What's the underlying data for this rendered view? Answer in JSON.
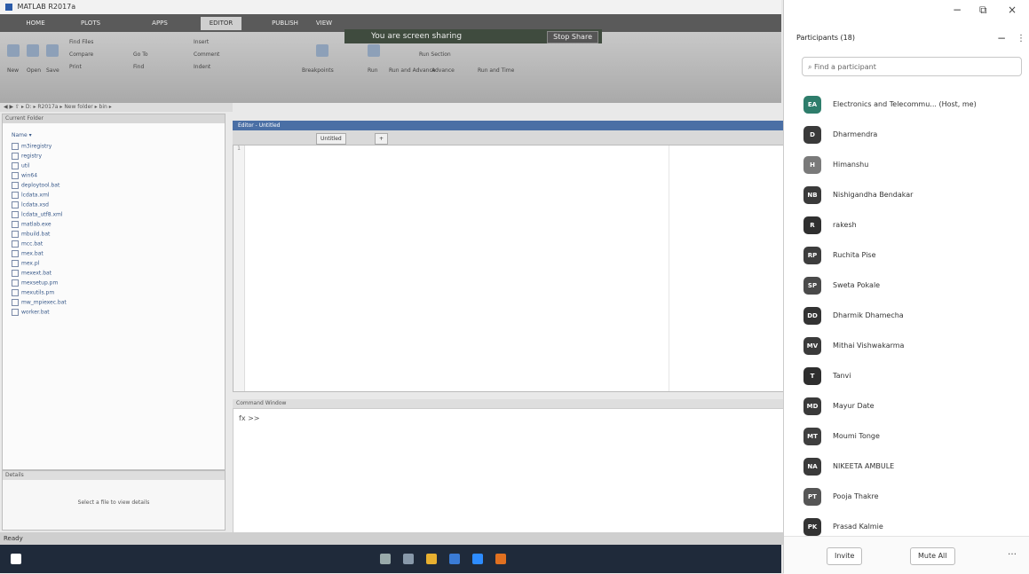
{
  "window": {
    "title": "MATLAB R2017a"
  },
  "ribbon_tabs": [
    "HOME",
    "PLOTS",
    "APPS",
    "EDITOR",
    "PUBLISH",
    "VIEW"
  ],
  "share_banner": {
    "text": "You are screen sharing",
    "stop_label": "Stop Share"
  },
  "ribbon": {
    "items": [
      "New",
      "Open",
      "Save",
      "Find Files",
      "Compare",
      "Print",
      "Go To",
      "Find",
      "Insert",
      "Comment",
      "Indent",
      "Breakpoints",
      "Run",
      "Run and Advance",
      "Run Section",
      "Advance",
      "Run and Time"
    ]
  },
  "address_bar": {
    "path": "▸ D: ▸ R2017a ▸ New folder ▸ bin ▸"
  },
  "current_folder": {
    "header": "Current Folder",
    "name_col": "Name ▾",
    "items": [
      "m3iregistry",
      "registry",
      "util",
      "win64",
      "deploytool.bat",
      "lcdata.xml",
      "lcdata.xsd",
      "lcdata_utf8.xml",
      "matlab.exe",
      "mbuild.bat",
      "mcc.bat",
      "mex.bat",
      "mex.pl",
      "mexext.bat",
      "mexsetup.pm",
      "mexutils.pm",
      "mw_mpiexec.bat",
      "worker.bat"
    ]
  },
  "details": {
    "header": "Details",
    "message": "Select a file to view details"
  },
  "editor": {
    "title": "Editor - Untitled",
    "tabs": [
      "Untitled",
      "+"
    ],
    "line_number": "1"
  },
  "command_window": {
    "header": "Command Window",
    "prompt": "fx >>"
  },
  "status_bar": {
    "text": "Ready"
  },
  "participants": {
    "title": "Participants (18)",
    "search_placeholder": "Find a participant",
    "people": [
      {
        "initials": "EA",
        "name": "Electronics and Telecommu... (Host, me)",
        "color": "#2e7d6b"
      },
      {
        "initials": "D",
        "name": "Dharmendra",
        "color": "#3a3a3a"
      },
      {
        "initials": "H",
        "name": "Himanshu",
        "color": "#7a7a7a"
      },
      {
        "initials": "NB",
        "name": "Nishigandha Bendakar",
        "color": "#3a3a3a"
      },
      {
        "initials": "R",
        "name": "rakesh",
        "color": "#2f2f2f"
      },
      {
        "initials": "RP",
        "name": "Ruchita Pise",
        "color": "#3d3d3d"
      },
      {
        "initials": "SP",
        "name": "Sweta Pokale",
        "color": "#4a4a4a"
      },
      {
        "initials": "DD",
        "name": "Dharmik Dhamecha",
        "color": "#333333"
      },
      {
        "initials": "MV",
        "name": "Mithai Vishwakarma",
        "color": "#3a3a3a"
      },
      {
        "initials": "T",
        "name": "Tanvi",
        "color": "#2e2e2e"
      },
      {
        "initials": "MD",
        "name": "Mayur Date",
        "color": "#3a3a3a"
      },
      {
        "initials": "MT",
        "name": "Moumi Tonge",
        "color": "#3f3f3f"
      },
      {
        "initials": "NA",
        "name": "NIKEETA AMBULE",
        "color": "#3a3a3a"
      },
      {
        "initials": "PT",
        "name": "Pooja Thakre",
        "color": "#555555"
      },
      {
        "initials": "PK",
        "name": "Prasad Kalmie",
        "color": "#333333"
      }
    ],
    "invite_label": "Invite",
    "mute_all_label": "Mute All"
  }
}
